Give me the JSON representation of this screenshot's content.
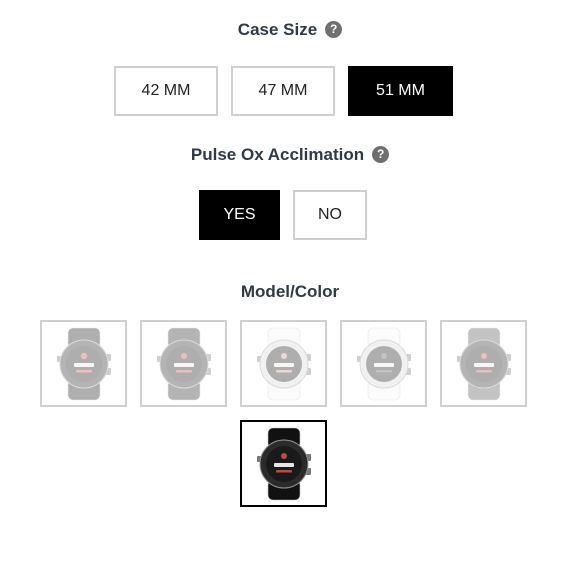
{
  "case_size": {
    "title": "Case Size",
    "help_icon": "?",
    "options": [
      "42 MM",
      "47 MM",
      "51 MM"
    ],
    "selected": "51 MM"
  },
  "pulse_ox": {
    "title": "Pulse Ox Acclimation",
    "help_icon": "?",
    "options": [
      "YES",
      "NO"
    ],
    "selected": "YES"
  },
  "model_color": {
    "title": "Model/Color",
    "swatches": [
      {
        "icon": "black-watch-icon",
        "band": "#1c1c1c",
        "accent": "#d24b3c",
        "selected": false
      },
      {
        "icon": "slate-watch-icon",
        "band": "#2a2a2a",
        "accent": "#c04a3b",
        "selected": false
      },
      {
        "icon": "white-rose-watch-icon",
        "band": "#f4f4f4",
        "accent": "#d9868a",
        "selected": false
      },
      {
        "icon": "white-silver-watch-icon",
        "band": "#f4f4f4",
        "accent": "#555555",
        "selected": false
      },
      {
        "icon": "gray-watch-icon",
        "band": "#555555",
        "accent": "#c04a3b",
        "selected": false
      },
      {
        "icon": "black-dlc-watch-icon",
        "band": "#111111",
        "accent": "#c04a3b",
        "selected": true
      }
    ]
  },
  "colors": {
    "selected_bg": "#000000",
    "border": "#cfcfcf",
    "title": "#2f3a47"
  }
}
